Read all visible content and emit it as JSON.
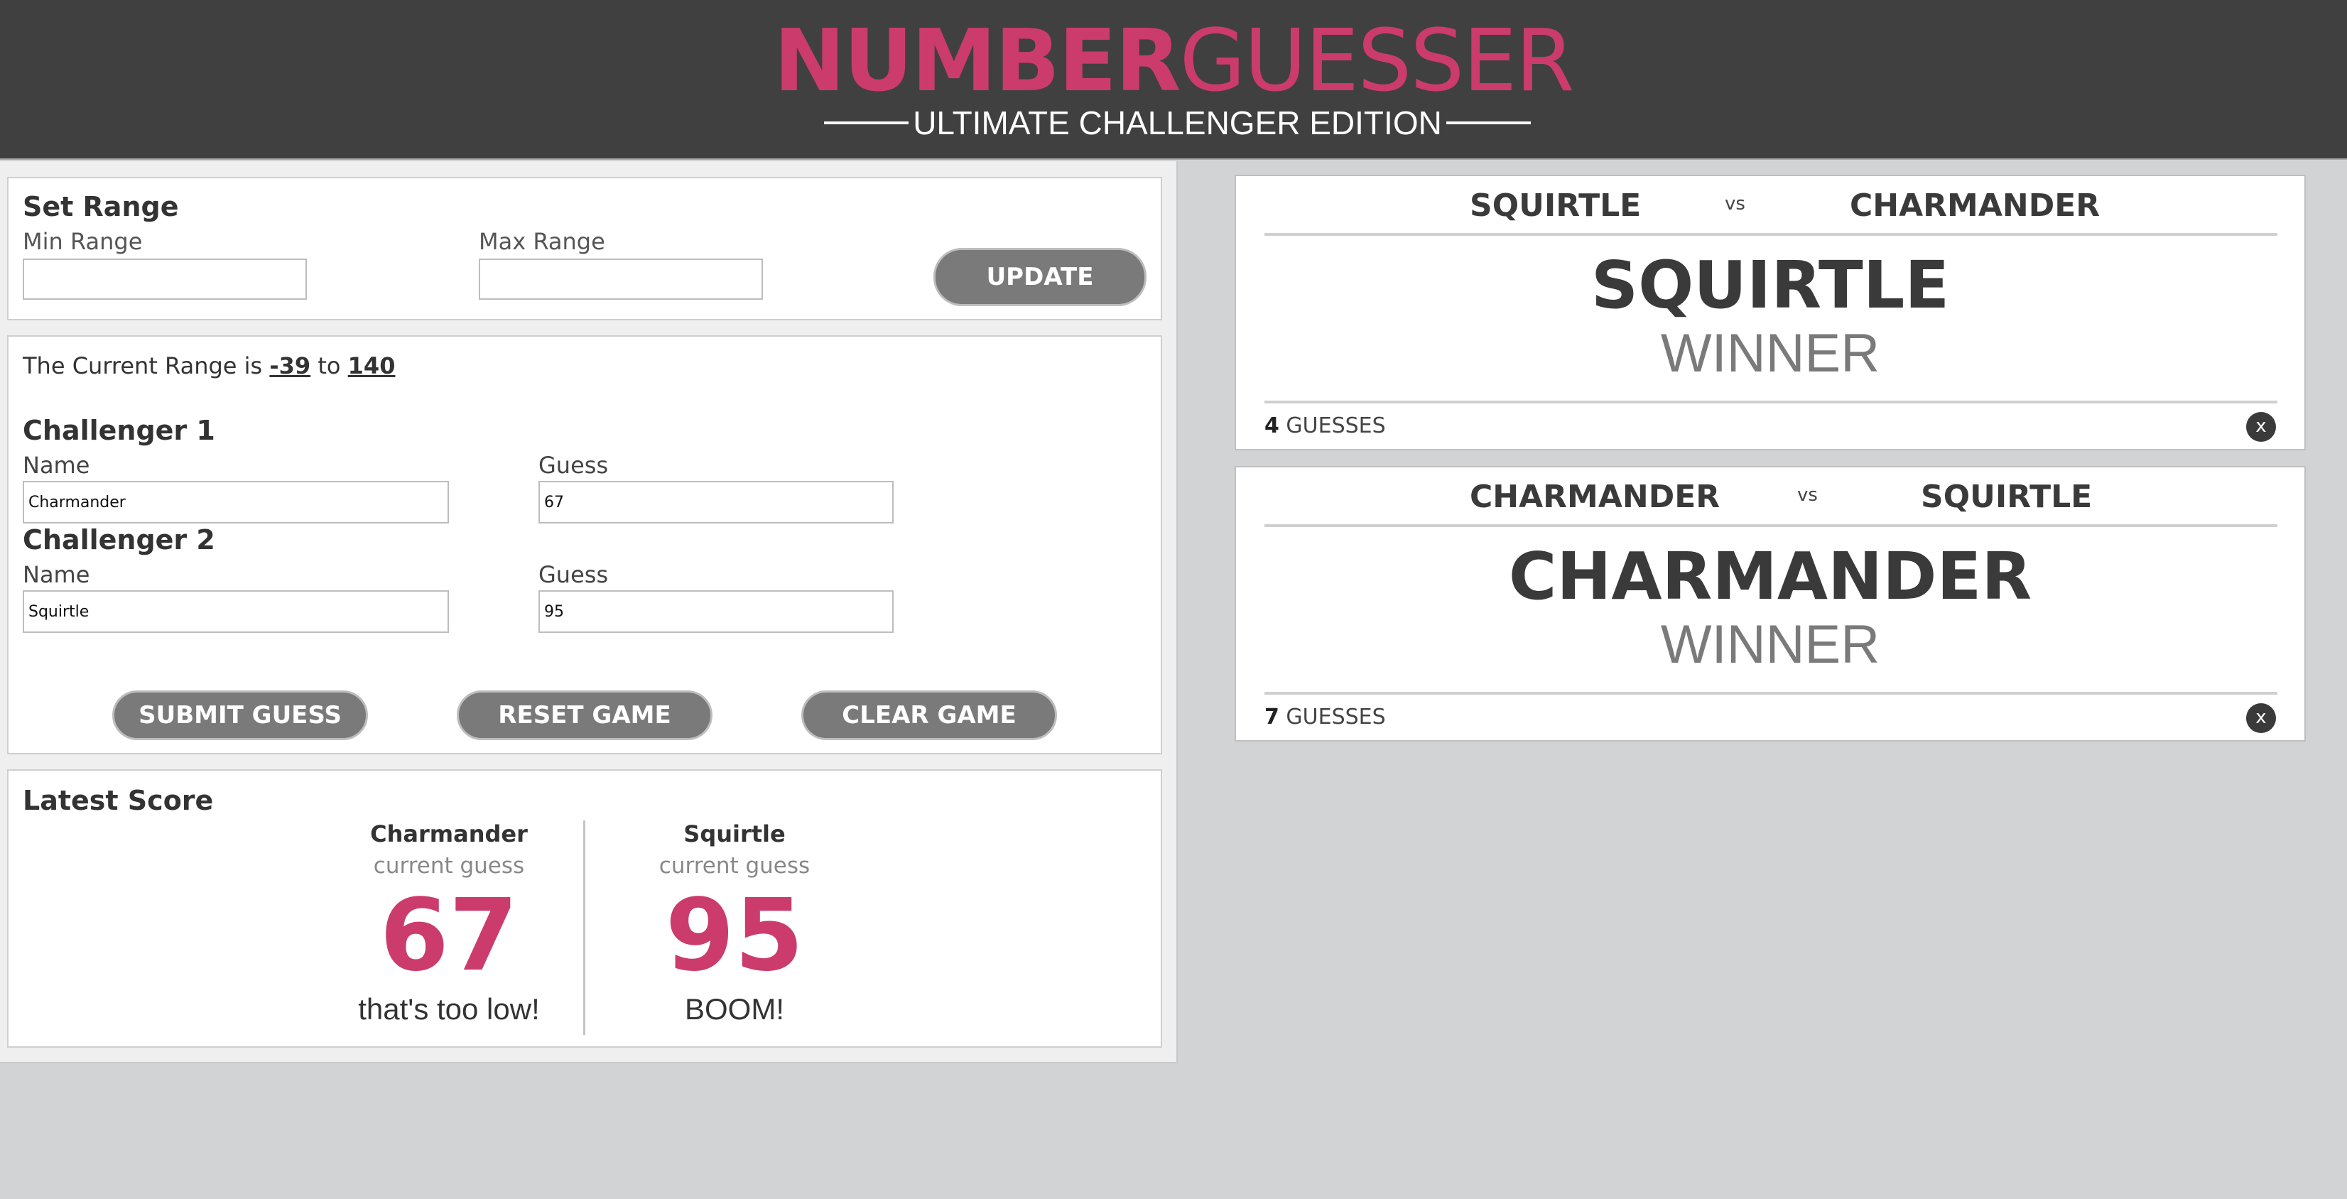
{
  "header": {
    "title_bold": "NUMBER",
    "title_light": "GUESSER",
    "subtitle": "ULTIMATE CHALLENGER EDITION"
  },
  "range_form": {
    "title": "Set Range",
    "min_label": "Min Range",
    "max_label": "Max Range",
    "min_value": "",
    "max_value": "",
    "update_label": "UPDATE"
  },
  "current_range": {
    "prefix": "The Current Range is ",
    "min": "-39",
    "to": " to ",
    "max": "140"
  },
  "challengers": [
    {
      "title": "Challenger 1",
      "name_label": "Name",
      "guess_label": "Guess",
      "name": "Charmander",
      "guess": "67"
    },
    {
      "title": "Challenger 2",
      "name_label": "Name",
      "guess_label": "Guess",
      "name": "Squirtle",
      "guess": "95"
    }
  ],
  "buttons": {
    "submit": "SUBMIT GUESS",
    "reset": "RESET GAME",
    "clear": "CLEAR GAME"
  },
  "latest_score": {
    "title": "Latest Score",
    "players": [
      {
        "name": "Charmander",
        "sub": "current guess",
        "guess": "67",
        "message": "that's too low!"
      },
      {
        "name": "Squirtle",
        "sub": "current guess",
        "guess": "95",
        "message": "BOOM!"
      }
    ]
  },
  "results": [
    {
      "player1": "SQUIRTLE",
      "vs": "vs",
      "player2": "CHARMANDER",
      "winner": "SQUIRTLE",
      "winner_label": "WINNER",
      "guess_count": "4",
      "guess_suffix": " GUESSES",
      "close": "x"
    },
    {
      "player1": "CHARMANDER",
      "vs": "vs",
      "player2": "SQUIRTLE",
      "winner": "CHARMANDER",
      "winner_label": "WINNER",
      "guess_count": "7",
      "guess_suffix": " GUESSES",
      "close": "x"
    }
  ],
  "colors": {
    "accent": "#cb3b6b",
    "header_bg": "#404040",
    "page_bg": "#d2d3d5",
    "button_bg": "#7a7a7a"
  }
}
